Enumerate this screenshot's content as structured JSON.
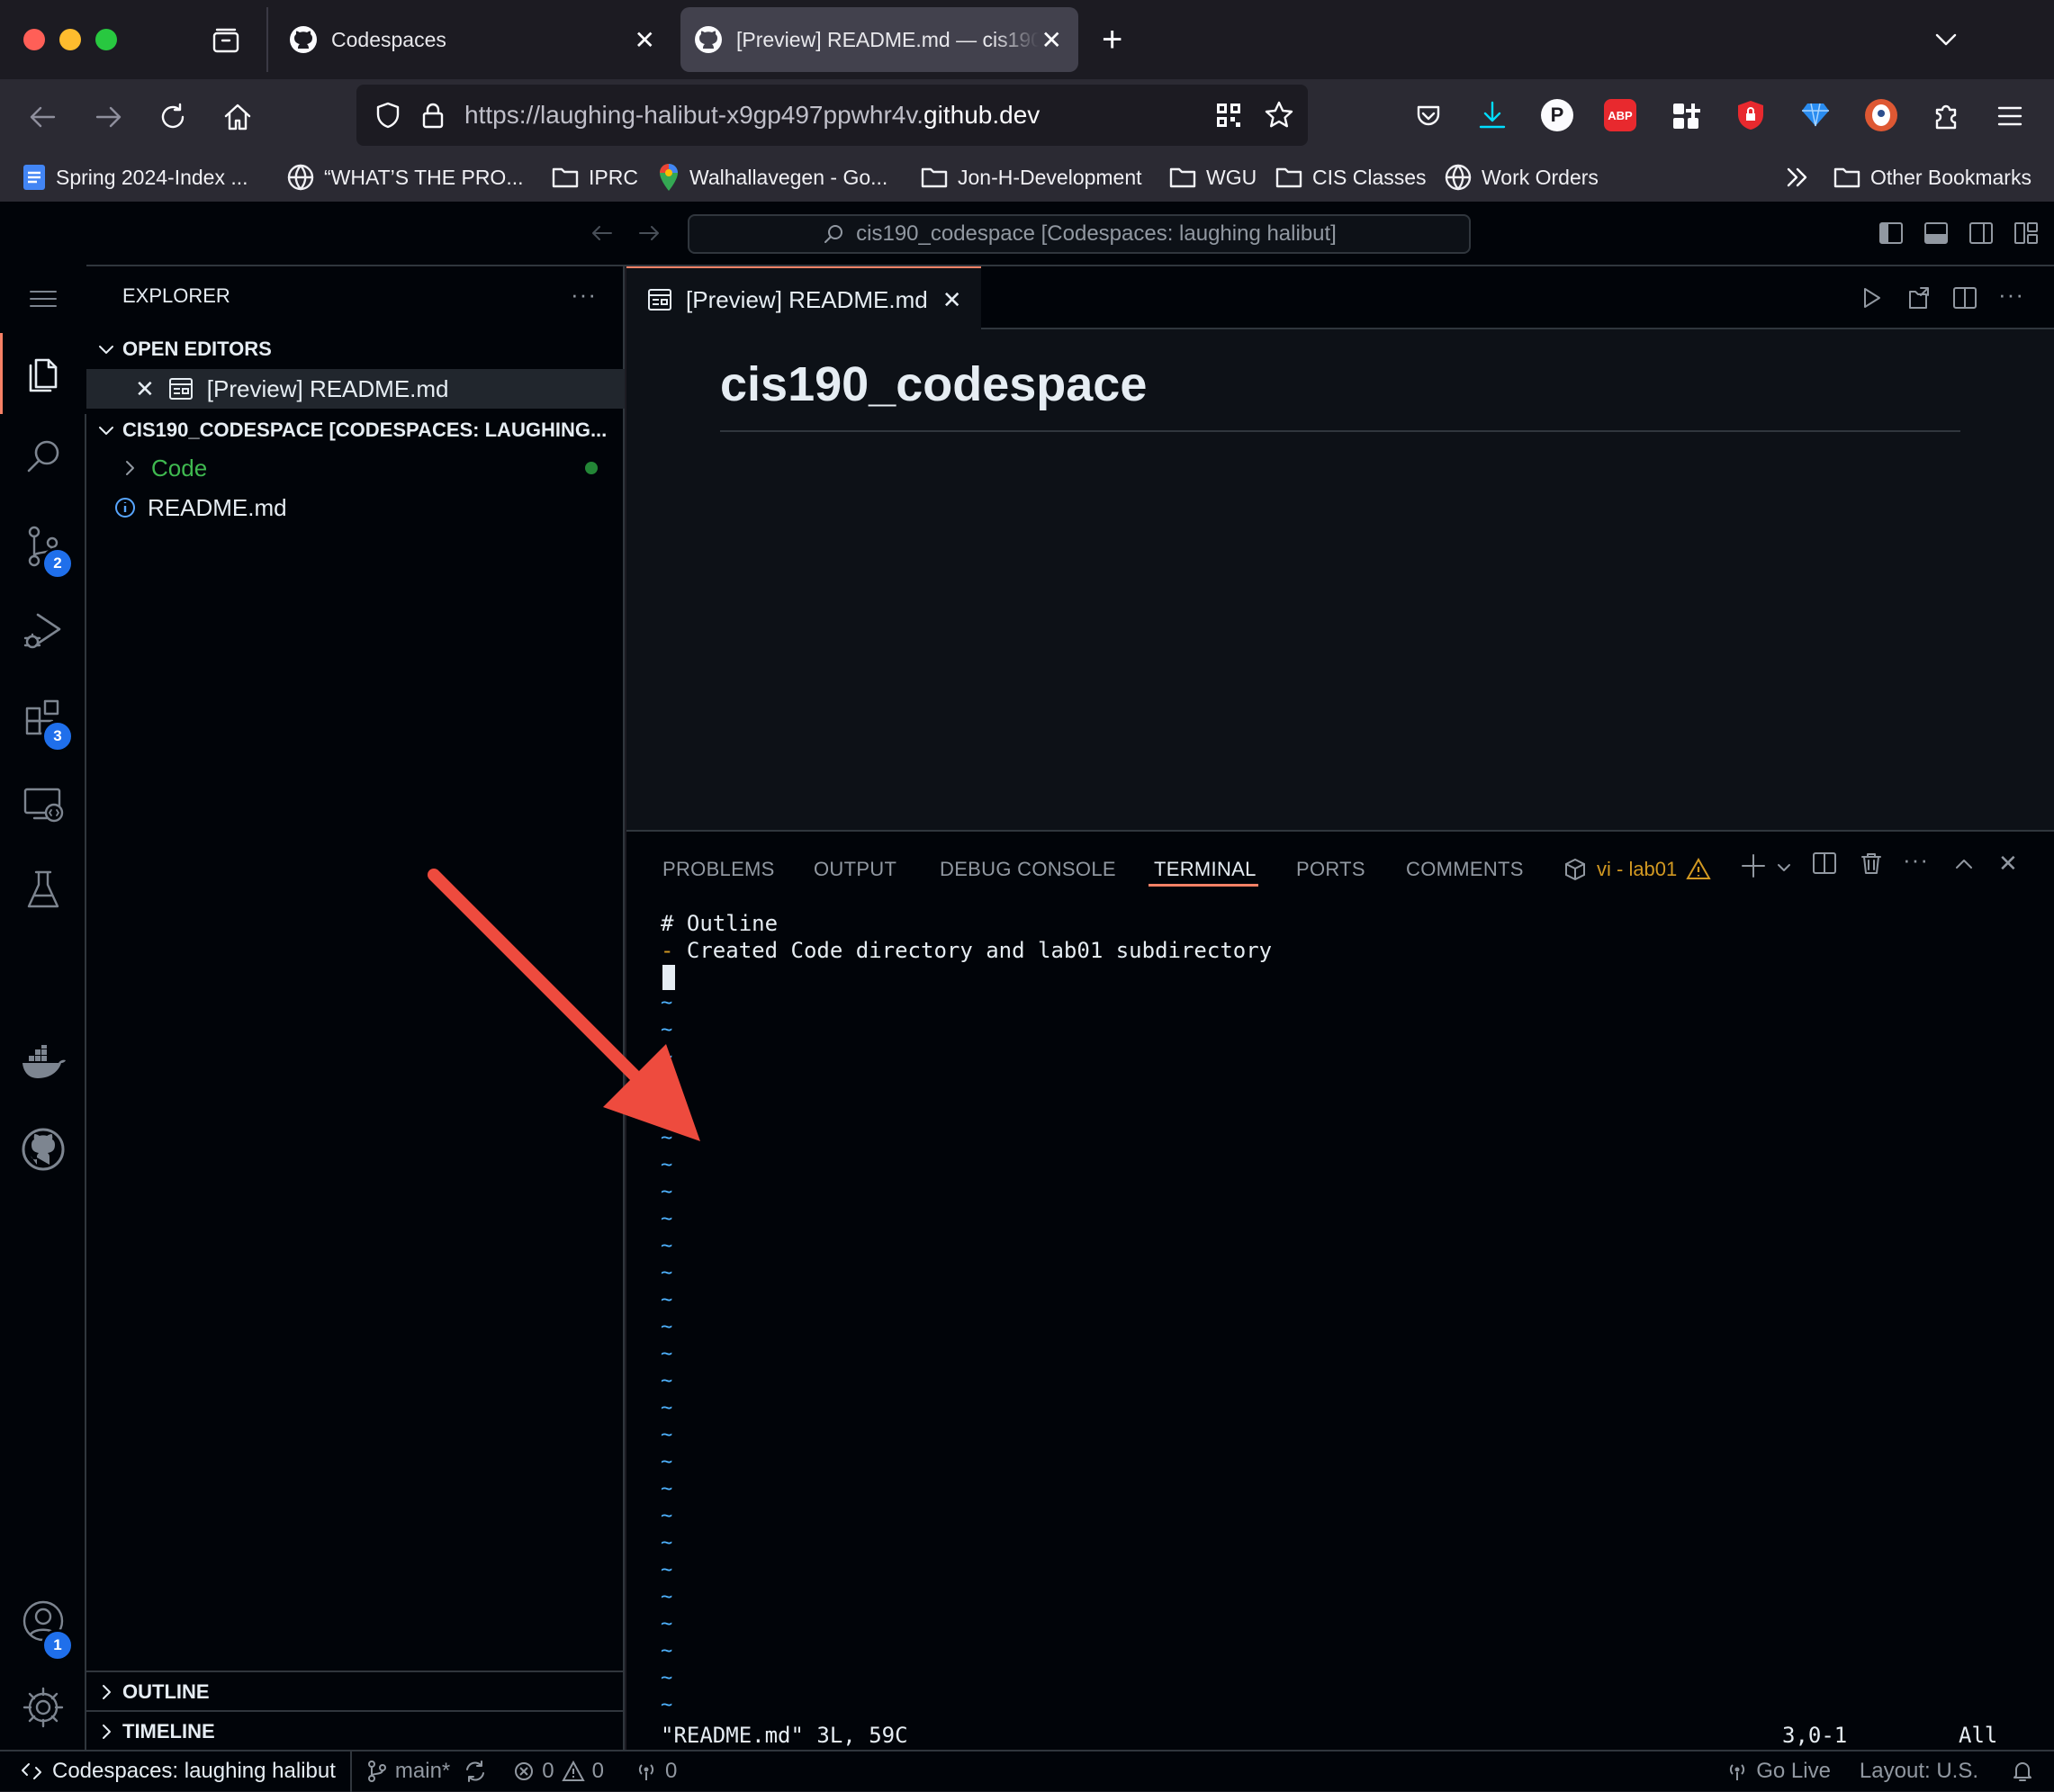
{
  "browser": {
    "tabs": [
      {
        "label": "Codespaces",
        "active": false
      },
      {
        "label": "[Preview] README.md — cis190",
        "active": true
      }
    ],
    "url": {
      "prefix": "https://laughing-halibut-x9gp497ppwhr4v.",
      "domain": "github.dev"
    },
    "bookmarks": [
      {
        "label": "Spring 2024-Index ...",
        "icon": "doc-icon"
      },
      {
        "label": "“WHAT’S THE PRO...",
        "icon": "globe-icon"
      },
      {
        "label": "IPRC",
        "icon": "folder-icon"
      },
      {
        "label": "Walhallavegen - Go...",
        "icon": "maps-pin-icon"
      },
      {
        "label": "Jon-H-Development",
        "icon": "folder-icon"
      },
      {
        "label": "WGU",
        "icon": "folder-icon"
      },
      {
        "label": "CIS Classes",
        "icon": "folder-icon"
      },
      {
        "label": "Work Orders",
        "icon": "globe-icon"
      }
    ],
    "other_bookmarks": "Other Bookmarks",
    "colors": {
      "accent": "#0df"
    }
  },
  "vscode": {
    "command_center": "cis190_codespace [Codespaces: laughing halibut]",
    "activity_badges": {
      "source_control": "2",
      "extensions": "3",
      "accounts": "1"
    },
    "explorer": {
      "title": "EXPLORER",
      "open_editors_header": "OPEN EDITORS",
      "open_editor_item": "[Preview] README.md",
      "workspace_header": "CIS190_CODESPACE [CODESPACES: LAUGHING...",
      "items": [
        {
          "label": "Code",
          "type": "folder"
        },
        {
          "label": "README.md",
          "type": "file"
        }
      ],
      "outline": "OUTLINE",
      "timeline": "TIMELINE"
    },
    "editor": {
      "tab_label": "[Preview] README.md",
      "preview_heading": "cis190_codespace"
    },
    "panel": {
      "tabs": [
        "PROBLEMS",
        "OUTPUT",
        "DEBUG CONSOLE",
        "TERMINAL",
        "PORTS",
        "COMMENTS"
      ],
      "active_tab": "TERMINAL",
      "terminal_name": "vi - lab01"
    },
    "terminal": {
      "line1": "# Outline",
      "line2_bullet": "-",
      "line2_text": " Created Code directory and lab01 subdirectory",
      "tilde": "~",
      "status_left": "\"README.md\" 3L, 59C",
      "status_pos": "3,0-1",
      "status_all": "All"
    },
    "statusbar": {
      "remote": "Codespaces: laughing halibut",
      "branch": "main*",
      "errors": "0",
      "warnings": "0",
      "ports": "0",
      "go_live": "Go Live",
      "layout": "Layout: U.S."
    }
  }
}
